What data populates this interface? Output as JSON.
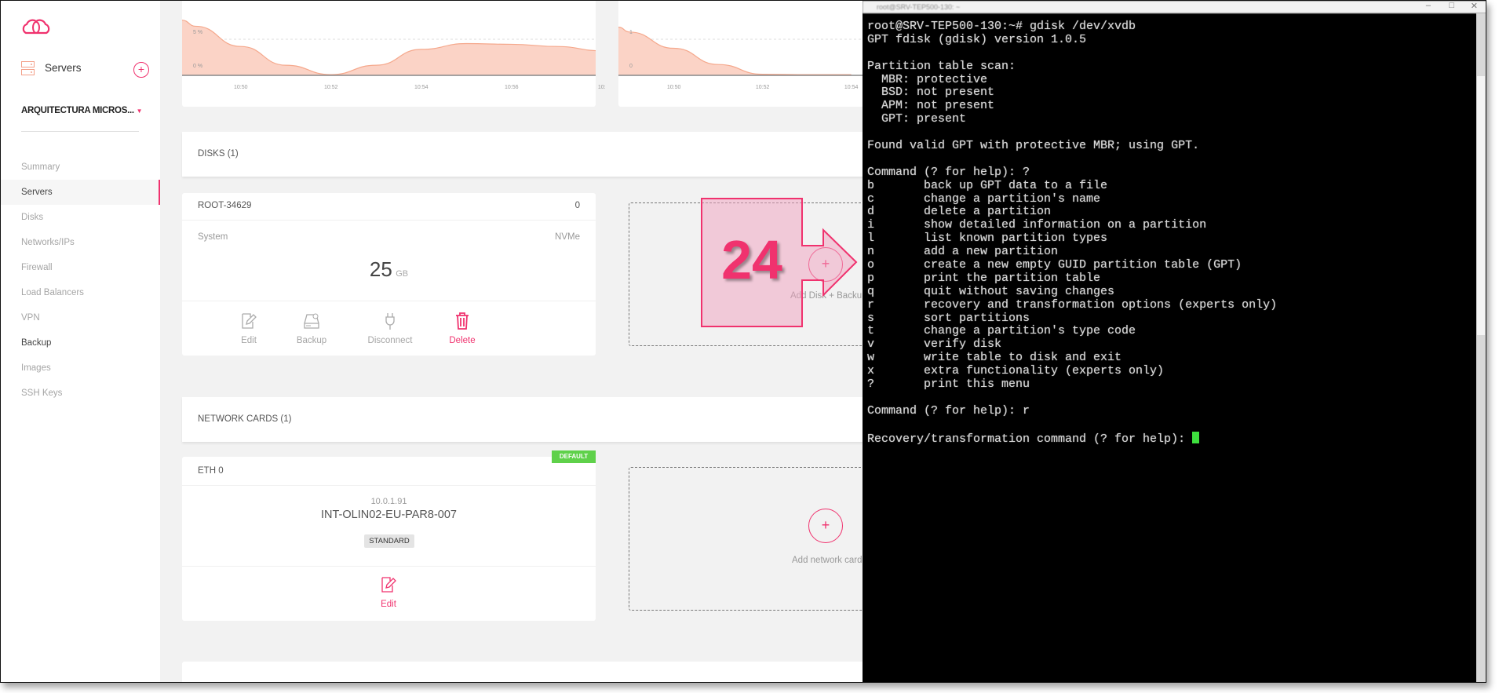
{
  "sidebar": {
    "section_title": "Servers",
    "project": "ARQUITECTURA MICROS...",
    "items": [
      {
        "label": "Summary"
      },
      {
        "label": "Servers"
      },
      {
        "label": "Disks"
      },
      {
        "label": "Networks/IPs"
      },
      {
        "label": "Firewall"
      },
      {
        "label": "Load Balancers"
      },
      {
        "label": "VPN"
      },
      {
        "label": "Backup"
      },
      {
        "label": "Images"
      },
      {
        "label": "SSH Keys"
      }
    ],
    "active_item": "Servers"
  },
  "charts": [
    {
      "type": "area",
      "y_ticks": [
        "5 %",
        "0 %"
      ],
      "x_ticks": [
        "10:50",
        "10:52",
        "10:54",
        "10:56",
        "10:"
      ],
      "x": [
        "10:49",
        "10:50",
        "10:51",
        "10:52",
        "10:53",
        "10:54",
        "10:55",
        "10:56",
        "10:57",
        "10:58"
      ],
      "values": [
        6.8,
        4.0,
        1.4,
        0.1,
        1.4,
        3.6,
        4.4,
        4.3,
        4.0,
        3.4
      ],
      "ylim": [
        0,
        5
      ]
    },
    {
      "type": "area",
      "y_ticks": [
        "1",
        "0"
      ],
      "x_ticks": [
        "10:50",
        "10:52",
        "10:54"
      ],
      "x": [
        "10:49",
        "10:50",
        "10:51",
        "10:52",
        "10:53",
        "10:54"
      ],
      "values": [
        1.2,
        0.75,
        0.3,
        0.03,
        0.02,
        0.02
      ],
      "ylim": [
        0,
        1
      ]
    }
  ],
  "disks": {
    "header": "DISKS (1)",
    "card": {
      "name": "ROOT-34629",
      "index": "0",
      "type": "System",
      "interface": "NVMe",
      "size": "25",
      "unit": "GB"
    },
    "actions": {
      "edit": "Edit",
      "backup": "Backup",
      "disconnect": "Disconnect",
      "delete": "Delete"
    },
    "add_label": "Add Disk + Backup"
  },
  "network": {
    "header": "NETWORK CARDS (1)",
    "badge": "DEFAULT",
    "card": {
      "name": "ETH 0",
      "ip": "10.0.1.91",
      "network": "INT-OLIN02-EU-PAR8-007",
      "tier": "STANDARD"
    },
    "edit": "Edit",
    "add_label": "Add network card"
  },
  "annotation": {
    "number": "24"
  },
  "terminal": {
    "title": "root@SRV-TEP500-130: ~",
    "lines": [
      "root@SRV-TEP500-130:~# gdisk /dev/xvdb",
      "GPT fdisk (gdisk) version 1.0.5",
      "",
      "Partition table scan:",
      "  MBR: protective",
      "  BSD: not present",
      "  APM: not present",
      "  GPT: present",
      "",
      "Found valid GPT with protective MBR; using GPT.",
      "",
      "Command (? for help): ?",
      "b       back up GPT data to a file",
      "c       change a partition's name",
      "d       delete a partition",
      "i       show detailed information on a partition",
      "l       list known partition types",
      "n       add a new partition",
      "o       create a new empty GUID partition table (GPT)",
      "p       print the partition table",
      "q       quit without saving changes",
      "r       recovery and transformation options (experts only)",
      "s       sort partitions",
      "t       change a partition's type code",
      "v       verify disk",
      "w       write table to disk and exit",
      "x       extra functionality (experts only)",
      "?       print this menu",
      "",
      "Command (? for help): r",
      "",
      "Recovery/transformation command (? for help): "
    ]
  },
  "colors": {
    "accent": "#f0326e",
    "chart_fill": "#fbd3c6",
    "chart_line": "#f5a88c",
    "badge_green": "#5fd14a",
    "cursor": "#3ee03e"
  }
}
